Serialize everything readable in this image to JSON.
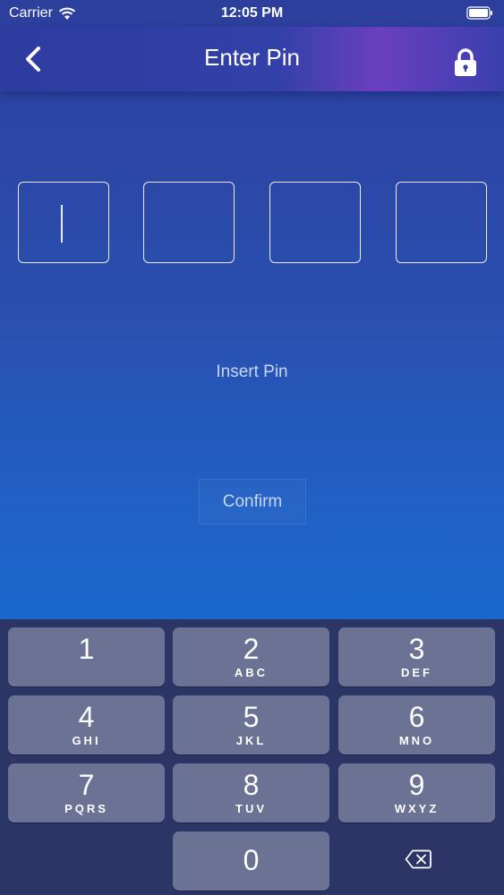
{
  "status": {
    "carrier": "Carrier",
    "time": "12:05 PM"
  },
  "nav": {
    "title": "Enter Pin",
    "back_icon": "chevron-left-icon",
    "lock_icon": "lock-icon"
  },
  "pin": {
    "digits": [
      "",
      "",
      "",
      ""
    ],
    "focused_index": 0
  },
  "hint": "Insert Pin",
  "confirm_label": "Confirm",
  "keypad": {
    "keys": [
      {
        "digit": "1",
        "letters": ""
      },
      {
        "digit": "2",
        "letters": "ABC"
      },
      {
        "digit": "3",
        "letters": "DEF"
      },
      {
        "digit": "4",
        "letters": "GHI"
      },
      {
        "digit": "5",
        "letters": "JKL"
      },
      {
        "digit": "6",
        "letters": "MNO"
      },
      {
        "digit": "7",
        "letters": "PQRS"
      },
      {
        "digit": "8",
        "letters": "TUV"
      },
      {
        "digit": "9",
        "letters": "WXYZ"
      },
      {
        "digit": "0",
        "letters": ""
      }
    ],
    "delete_icon": "backspace-icon"
  },
  "colors": {
    "accent": "#2d3f9c",
    "key": "#6b7294",
    "keypad_bg": "#2b3566"
  }
}
